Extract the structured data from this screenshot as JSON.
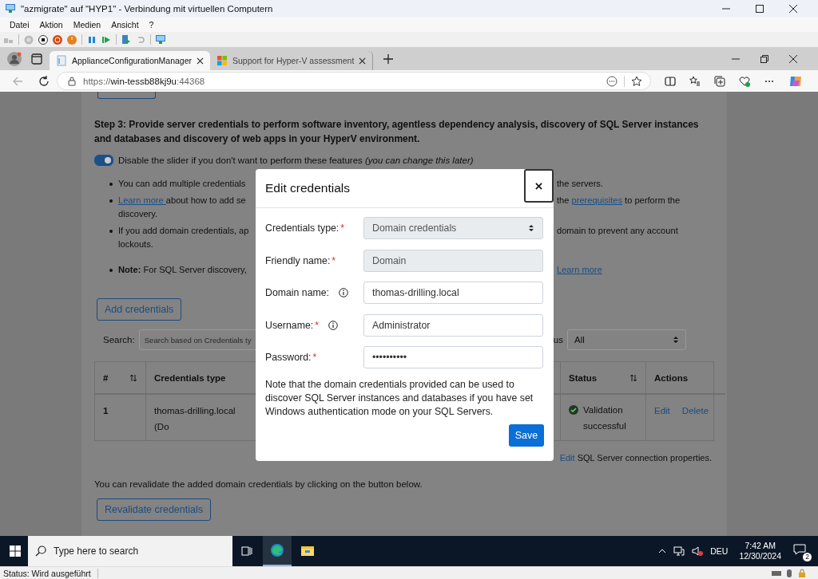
{
  "window": {
    "title": "\"azmigrate\" auf \"HYP1\" - Verbindung mit virtuellen Computern"
  },
  "menu": [
    "Datei",
    "Aktion",
    "Medien",
    "Ansicht",
    "?"
  ],
  "browser": {
    "tabs": [
      {
        "title": "ApplianceConfigurationManager",
        "selected": true
      },
      {
        "title": "Support for Hyper-V assessment",
        "selected": false
      }
    ],
    "back_disabled": true,
    "url": [
      {
        "text": "https://",
        "kind": "dim"
      },
      {
        "text": "win-tessb88kj9u",
        "kind": "host"
      },
      {
        "text": ":44368",
        "kind": "dim"
      }
    ]
  },
  "page": {
    "heading": "Step 3: Provide server credentials to perform software inventory, agentless dependency analysis, discovery of SQL Server instances and databases and discovery of web apps in your HyperV environment.",
    "toggle": {
      "on": true,
      "label": "Disable the slider if you don't want to perform these features *(you can change this later)*"
    },
    "bullets": [
      {
        "lines": [
          {
            "left": [
              {
                "text": "You can add multiple credentials",
                "kind": "text"
              }
            ],
            "right": [
              {
                "text": "the servers.",
                "kind": "text"
              }
            ]
          }
        ]
      },
      {
        "lines": [
          {
            "left": [
              {
                "text": "Learn more ",
                "kind": "link"
              },
              {
                "text": "about how to add se",
                "kind": "text"
              }
            ],
            "right": [
              {
                "text": "the ",
                "kind": "text"
              },
              {
                "text": "prerequisites",
                "kind": "link"
              },
              {
                "text": " to perform the",
                "kind": "text"
              }
            ]
          },
          {
            "left": [
              {
                "text": "discovery.",
                "kind": "text"
              }
            ]
          }
        ]
      },
      {
        "lines": [
          {
            "left": [
              {
                "text": "If you add domain credentials, ap",
                "kind": "text"
              }
            ],
            "right": [
              {
                "text": "domain to prevent any account",
                "kind": "text"
              }
            ]
          },
          {
            "left": [
              {
                "text": "lockouts.",
                "kind": "text"
              }
            ]
          }
        ]
      },
      {
        "lines": [
          {
            "left": [
              {
                "text": "**Note:** For SQL Server discovery,",
                "kind": "text"
              }
            ],
            "right": [
              {
                "text": "Learn more",
                "kind": "link"
              }
            ]
          }
        ]
      }
    ],
    "add_button": "Add credentials",
    "search": {
      "label": "Search:",
      "placeholder": "Search based on Credentials ty",
      "status_label": "us",
      "status_value": "All"
    },
    "table": {
      "columns": [
        {
          "label": "#",
          "sortable": true
        },
        {
          "label": "Credentials type",
          "sortable": false
        },
        {
          "label": "Status",
          "sortable": true
        },
        {
          "label": "Actions",
          "sortable": false
        }
      ],
      "rows": [
        {
          "number": "1",
          "type": "thomas-drilling.local (Do",
          "status": "Validation successful",
          "actions": [
            "Edit",
            "Delete"
          ]
        }
      ]
    },
    "edit_note": {
      "link": "Edit",
      "text": " SQL Server connection properties."
    },
    "revalidate_text": "You can revalidate the added domain credentials by clicking on the button below.",
    "revalidate_button": "Revalidate credentials"
  },
  "modal": {
    "title": "Edit credentials",
    "fields": [
      {
        "label": "Credentials type:",
        "required_mark": "*",
        "info": false,
        "kind": "select",
        "value": "Domain credentials",
        "disabled": true
      },
      {
        "label": "Friendly name:",
        "required_mark": "*",
        "info": false,
        "kind": "text",
        "value": "Domain",
        "disabled": true
      },
      {
        "label": "Domain name:",
        "info": true,
        "kind": "text",
        "value": "thomas-drilling.local",
        "disabled": false
      },
      {
        "label": "Username: ",
        "required_mark": "*",
        "info": true,
        "kind": "text",
        "value": "Administrator",
        "disabled": false
      },
      {
        "label": "Password:",
        "required_mark": "*",
        "info": false,
        "kind": "text",
        "value": "••••••••••",
        "disabled": false
      }
    ],
    "note": "Note that the domain credentials provided can be used to discover SQL Server instances and databases if you have set Windows authentication mode on your SQL Servers.",
    "save": "Save"
  },
  "taskbar": {
    "search_placeholder": "Type here to search",
    "apps": [
      {
        "kind": "taskview",
        "active": false
      },
      {
        "kind": "edge",
        "active": true
      },
      {
        "kind": "explorer",
        "active": false
      }
    ],
    "language": "DEU",
    "time": "7:42 AM",
    "date": "12/30/2024",
    "notifications": "2"
  },
  "status_bar": "Status: Wird ausgeführt"
}
